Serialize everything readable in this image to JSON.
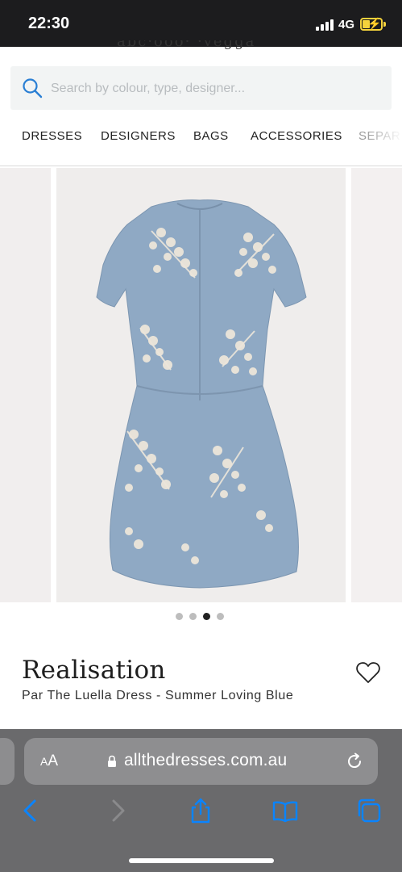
{
  "status_bar": {
    "time": "22:30",
    "network": "4G",
    "signal_icon": "cellular-signal-icon",
    "battery_icon": "battery-charging-icon"
  },
  "search": {
    "placeholder": "Search by colour, type, designer...",
    "icon": "search-icon"
  },
  "nav": {
    "items": [
      {
        "label": "DRESSES"
      },
      {
        "label": "DESIGNERS"
      },
      {
        "label": "BAGS"
      },
      {
        "label": "ACCESSORIES"
      },
      {
        "label": "SEPAR"
      }
    ]
  },
  "carousel": {
    "total_slides": 4,
    "active_slide": 3,
    "image": "dress-back-photo"
  },
  "product": {
    "designer": "Realisation",
    "name": "Par The Luella Dress - Summer Loving Blue",
    "wishlist_icon": "heart-icon"
  },
  "browser": {
    "text_size_label": "AA",
    "url": "allthedresses.com.au",
    "icons": [
      "lock-icon",
      "reload-icon",
      "back-icon",
      "forward-icon",
      "share-icon",
      "bookmarks-icon",
      "tabs-icon"
    ]
  },
  "colors": {
    "dress_blue": "#8fa9c4",
    "safari_accent": "#0a84ff",
    "status_bar_bg": "#1c1c1e",
    "battery_yellow": "#f4d23c"
  }
}
